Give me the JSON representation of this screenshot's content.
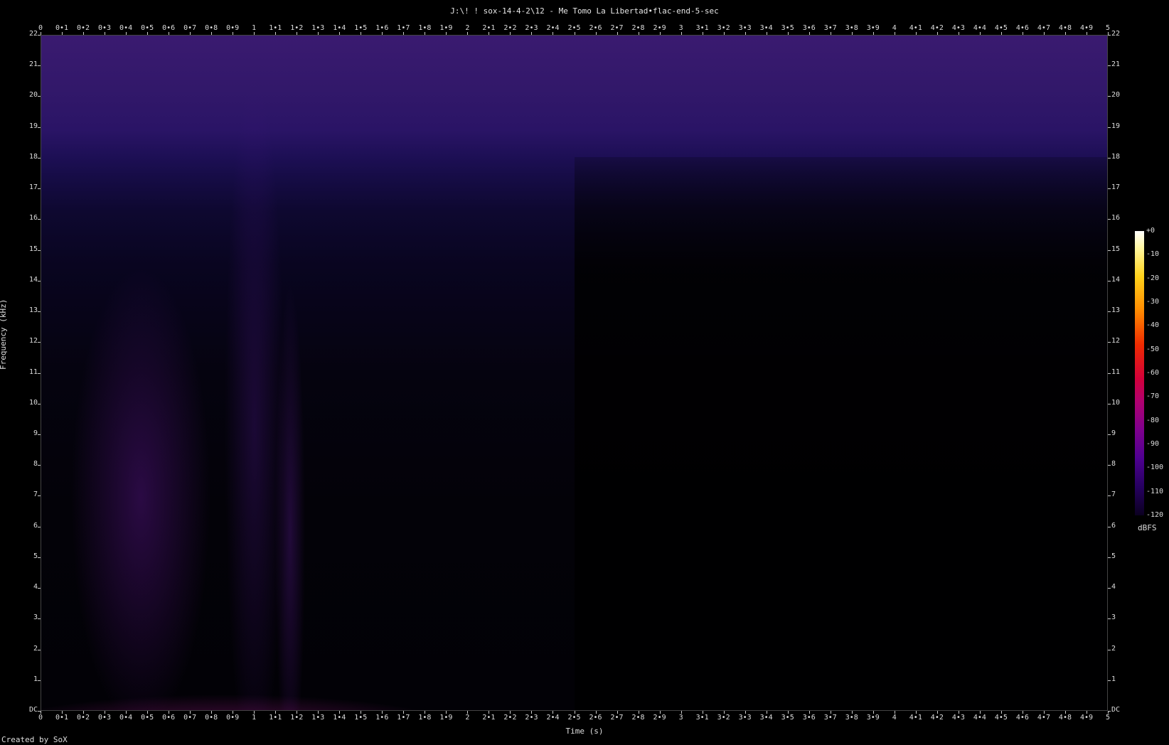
{
  "chart_data": {
    "type": "heatmap",
    "title": "J:\\! ! sox-14-4-2\\12 - Me Tomo La Libertad•flac-end-5-sec",
    "xlabel": "Time (s)",
    "ylabel": "Frequency (kHz)",
    "xlim": [
      0,
      5
    ],
    "ylim": [
      0,
      22
    ],
    "x_ticks": [
      "0",
      "0•1",
      "0•2",
      "0•3",
      "0•4",
      "0•5",
      "0•6",
      "0•7",
      "0•8",
      "0•9",
      "1",
      "1•1",
      "1•2",
      "1•3",
      "1•4",
      "1•5",
      "1•6",
      "1•7",
      "1•8",
      "1•9",
      "2",
      "2•1",
      "2•2",
      "2•3",
      "2•4",
      "2•5",
      "2•6",
      "2•7",
      "2•8",
      "2•9",
      "3",
      "3•1",
      "3•2",
      "3•3",
      "3•4",
      "3•5",
      "3•6",
      "3•7",
      "3•8",
      "3•9",
      "4",
      "4•1",
      "4•2",
      "4•3",
      "4•4",
      "4•5",
      "4•6",
      "4•7",
      "4•8",
      "4•9",
      "5"
    ],
    "y_ticks": [
      "DC",
      "1",
      "2",
      "3",
      "4",
      "5",
      "6",
      "7",
      "8",
      "9",
      "10",
      "11",
      "12",
      "13",
      "14",
      "15",
      "16",
      "17",
      "18",
      "19",
      "20",
      "21",
      "22"
    ],
    "colorbar": {
      "label": "dBFS",
      "ticks": [
        "+0",
        "-10",
        "-20",
        "-30",
        "-40",
        "-50",
        "-60",
        "-70",
        "-80",
        "-90",
        "-100",
        "-110",
        "-120"
      ],
      "range": [
        -120,
        0
      ]
    },
    "grid": false
  },
  "footer": {
    "credit": "Created by SoX"
  }
}
